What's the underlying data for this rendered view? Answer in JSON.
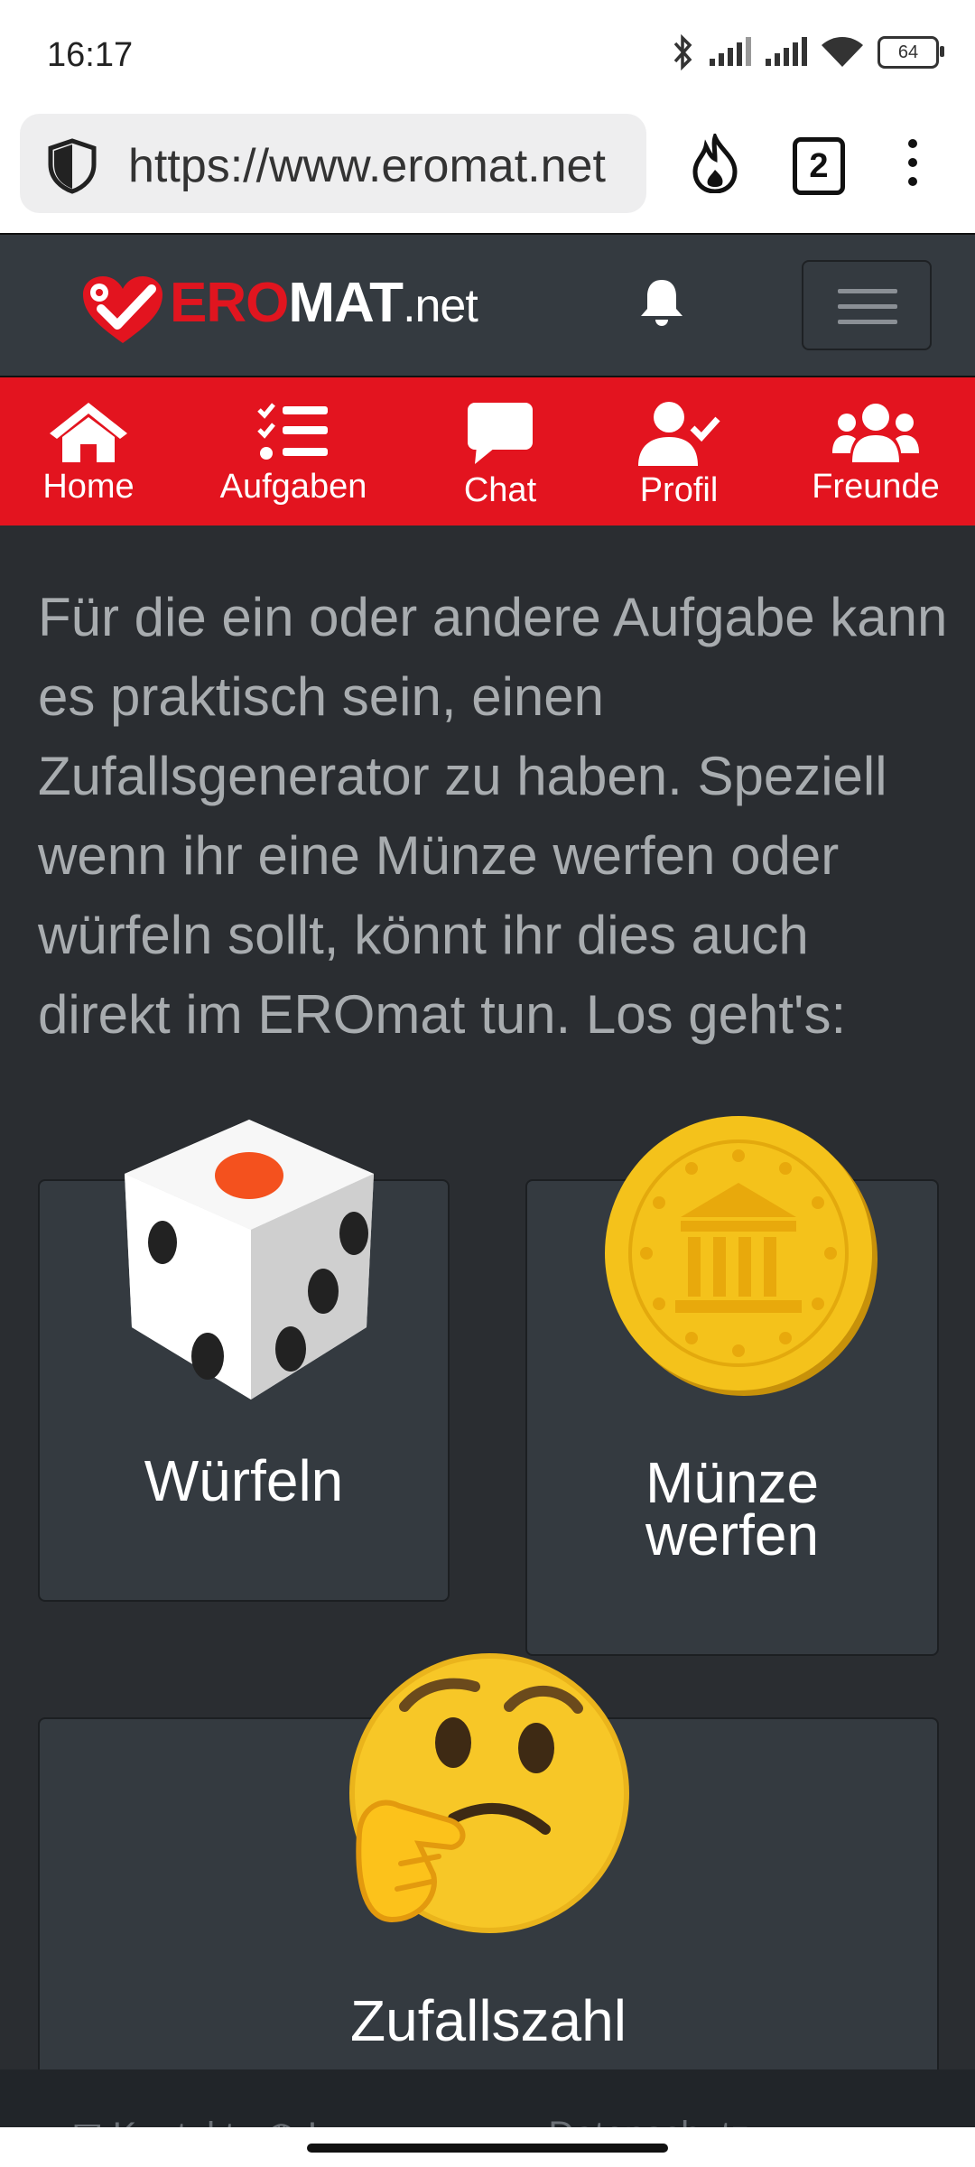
{
  "status_bar": {
    "time": "16:17",
    "battery": "64"
  },
  "browser": {
    "url": "https://www.eromat.net",
    "tab_count": "2"
  },
  "header": {
    "logo_part1": "ERO",
    "logo_part2": "MAT",
    "logo_part3": ".net"
  },
  "nav": [
    {
      "label": "Home",
      "icon": "home-icon"
    },
    {
      "label": "Aufgaben",
      "icon": "tasks-icon"
    },
    {
      "label": "Chat",
      "icon": "chat-icon"
    },
    {
      "label": "Profil",
      "icon": "profile-icon"
    },
    {
      "label": "Freunde",
      "icon": "friends-icon"
    }
  ],
  "intro": "Für die ein oder andere Aufgabe kann es praktisch sein, einen Zufallsgenerator zu haben. Speziell wenn ihr eine Münze werfen oder würfeln sollt, könnt ihr dies auch direkt im EROmat tun. Los geht's:",
  "cards": [
    {
      "label": "Würfeln",
      "icon": "dice-icon"
    },
    {
      "label_line1": "Münze",
      "label_line2": "werfen",
      "icon": "coin-icon"
    },
    {
      "label": "Zufallszahl",
      "icon": "thinking-face-icon"
    }
  ],
  "footer": {
    "kontakt": "Kontakt",
    "impressum": "Impressum",
    "datenschutz": "Datenschutz"
  },
  "colors": {
    "brand_red": "#e3141f",
    "header_bg": "#343a40",
    "page_bg": "#2a2d31"
  }
}
